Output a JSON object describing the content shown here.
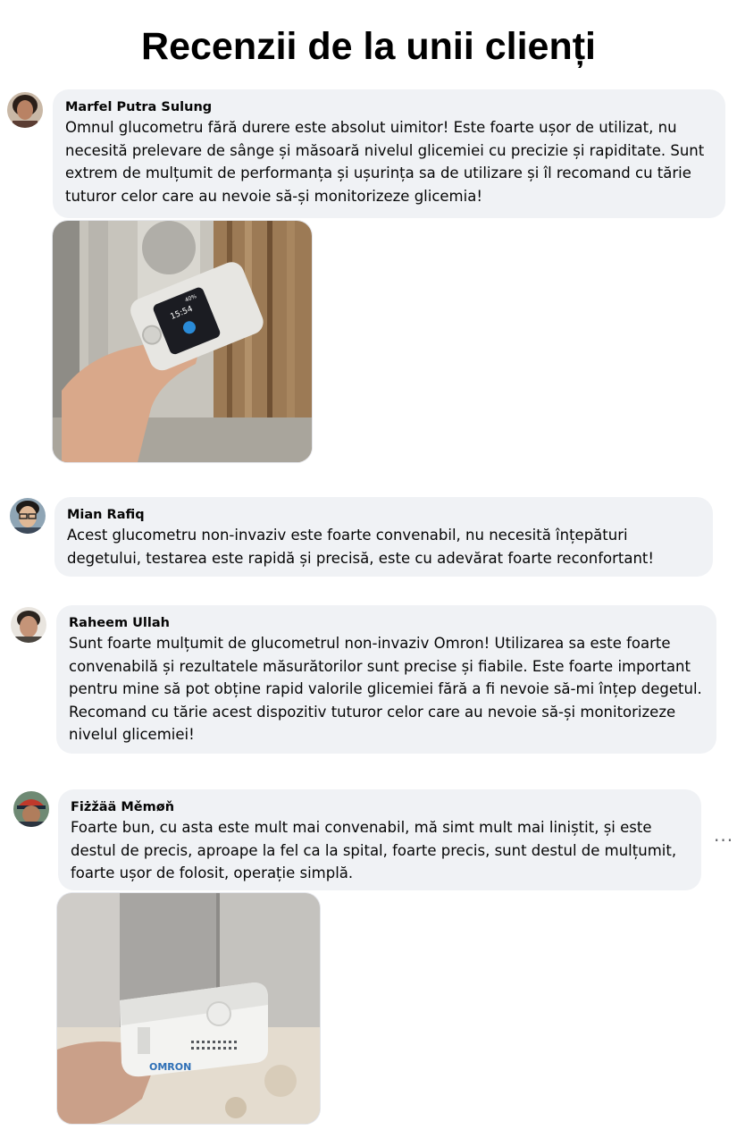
{
  "page": {
    "title": "Recenzii de la unii clienți"
  },
  "reviews": [
    {
      "author": "Marfel Putra Sulung",
      "text": "Omnul glucometru fără durere este absolut uimitor! Este foarte ușor de utilizat, nu necesită prelevare de sânge și măsoară nivelul glicemiei cu precizie și rapiditate. Sunt extrem de mulțumit de performanța și ușurința sa de utilizare și îl recomand cu tărie tuturor celor care au nevoie să-și monitorizeze glicemia!",
      "photo": {
        "device_time": "15:54",
        "device_battery": "40%"
      }
    },
    {
      "author": "Mian Rafiq",
      "text": "Acest glucometru non-invaziv este foarte convenabil, nu necesită înțepături degetului, testarea este rapidă și precisă, este cu adevărat foarte reconfortant!"
    },
    {
      "author": "Raheem Ullah",
      "text": "Sunt foarte mulțumit de glucometrul non-invaziv Omron! Utilizarea sa este foarte convenabilă și rezultatele măsurătorilor sunt precise și fiabile. Este foarte important pentru mine să pot obține rapid valorile glicemiei fără a fi nevoie să-mi înțep degetul. Recomand cu tărie acest dispozitiv tuturor celor care au nevoie să-și monitorizeze nivelul glicemiei!"
    },
    {
      "author": "Fiżžää Měmøň",
      "text": "Foarte bun, cu asta este mult mai convenabil, mă simt mult mai liniștit, și este destul de precis, aproape la fel ca la spital, foarte precis, sunt destul de mulțumit, foarte ușor de folosit, operație simplă.",
      "more_label": "···",
      "photo": {
        "brand": "OMRON"
      }
    }
  ]
}
